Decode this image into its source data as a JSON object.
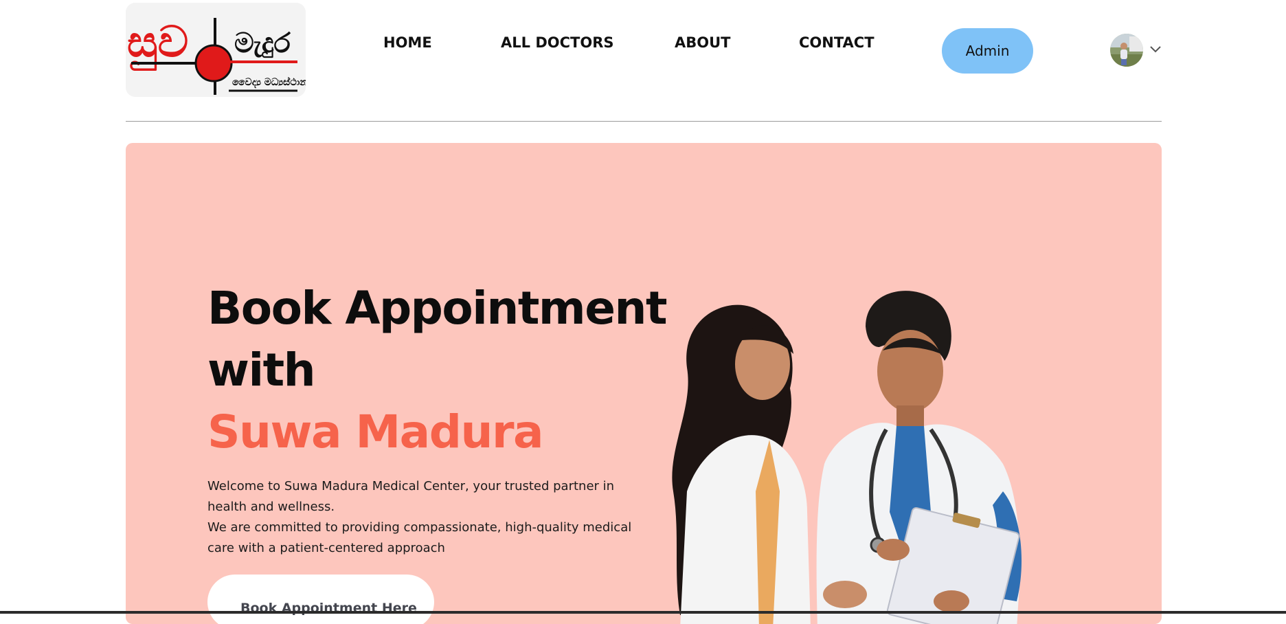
{
  "logo": {
    "alt": "Suwa Madura Medical Center logo",
    "text_line1_left": "සුව",
    "text_line1_right": "මැදුර",
    "text_line2": "වෛද්‍ය මධ්‍යස්ථානය"
  },
  "nav": {
    "items": [
      {
        "label": "HOME"
      },
      {
        "label": "ALL DOCTORS"
      },
      {
        "label": "ABOUT"
      },
      {
        "label": "CONTACT"
      }
    ],
    "admin_label": "Admin"
  },
  "user_menu": {
    "avatar_icon": "user-avatar",
    "chevron_icon": "chevron-down-icon"
  },
  "hero": {
    "title_line1": "Book Appointment",
    "title_line2": "with",
    "title_accent": "Suwa Madura",
    "description_1": "Welcome to Suwa Madura Medical Center, your trusted partner in health and wellness.",
    "description_2": "We are committed to providing compassionate, high-quality medical care with a patient-centered approach",
    "cta_label": "Book Appointment Here",
    "image_alt": "Two doctors reviewing a clipboard"
  },
  "colors": {
    "hero_bg": "#fdc6bd",
    "accent": "#f6634b",
    "admin_button": "#7fc2f7"
  }
}
